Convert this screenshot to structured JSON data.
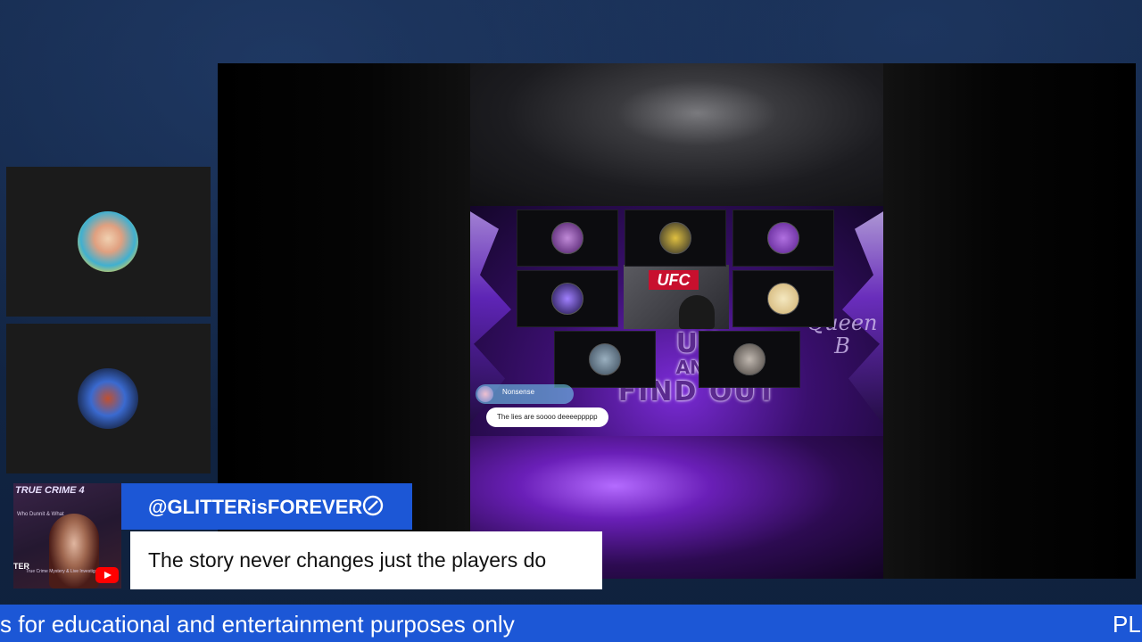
{
  "stream": {
    "overlay_text": {
      "queen_b": "Queen B",
      "fafo_line1": "UU",
      "fafo_line2": "AND",
      "fafo_line3": "FIND OUT",
      "center_cam_logo": "UFC"
    },
    "chat_popup": {
      "username": "Nonsense",
      "message": "The lies are soooo deeeeppppp"
    },
    "show_thumbnail": {
      "title": "TRUE CRIME 4",
      "subtitle": "Who Dunnit & What",
      "brand": "TER",
      "brand_sub": "True Crime Mystery & Live Investigations"
    },
    "lower_third": {
      "username": "@GLITTERisFOREVER",
      "message": "The story never changes just the players do"
    },
    "ticker": {
      "text": "s for educational and entertainment purposes only",
      "next_text": "PL"
    }
  },
  "icons": {
    "verified": "verified-badge-icon",
    "youtube": "youtube-icon"
  },
  "colors": {
    "brand_blue": "#1c57d6",
    "background": "#112442",
    "accent_purple": "#7a2bd6"
  }
}
